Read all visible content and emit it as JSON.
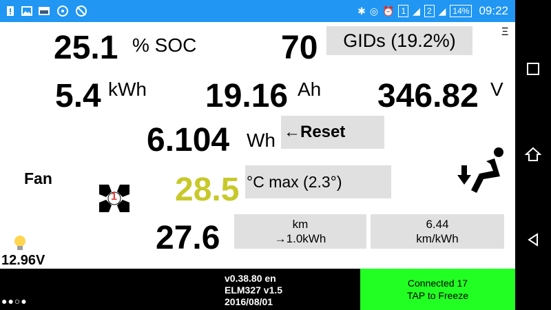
{
  "status_bar": {
    "left_icons": [
      "alert-icon",
      "image-icon",
      "photo-icon",
      "steering-icon",
      "no-wheel-icon"
    ],
    "right": {
      "icons": [
        "bluetooth-icon",
        "wifi-hotspot-icon",
        "alarm-icon"
      ],
      "sim1": "1",
      "sim2": "2",
      "battery_percent": "14%",
      "time": "09:22"
    }
  },
  "nav_bar": {
    "buttons": [
      "square-icon",
      "home-icon",
      "back-icon"
    ]
  },
  "row1": {
    "soc_value": "25.1",
    "soc_unit": "% SOC",
    "gids_value": "70",
    "gids_label": "GIDs (19.2%)",
    "menu_icon": "Ξ"
  },
  "row2": {
    "kwh_value": "5.4",
    "kwh_unit": "kWh",
    "ah_value": "19.16",
    "ah_unit": "Ah",
    "volt_value": "346.82",
    "volt_unit": "V"
  },
  "row3": {
    "wh_value": "6.104",
    "wh_unit": "Wh",
    "reset_label": "←Reset"
  },
  "row4": {
    "fan_label": "Fan",
    "fan_speed": "1",
    "temp_value": "28.5",
    "temp_label": "°C max (2.3°)",
    "temp_color": "#c8c82a"
  },
  "row5": {
    "bulb_icon": "bulb-icon",
    "aux_voltage": "12.96V",
    "range_value": "27.6",
    "km_label_line1": "km",
    "km_label_line2": "→1.0kWh",
    "efficiency_line1": "6.44",
    "efficiency_line2": "km/kWh"
  },
  "bottom": {
    "page_dots": "●●○●",
    "version_line1": "v0.38.80 en",
    "version_line2": "ELM327 v1.5",
    "version_line3": "2016/08/01",
    "connected_line1": "Connected 17",
    "connected_line2": "TAP to Freeze",
    "connected_color": "#22ff22"
  }
}
